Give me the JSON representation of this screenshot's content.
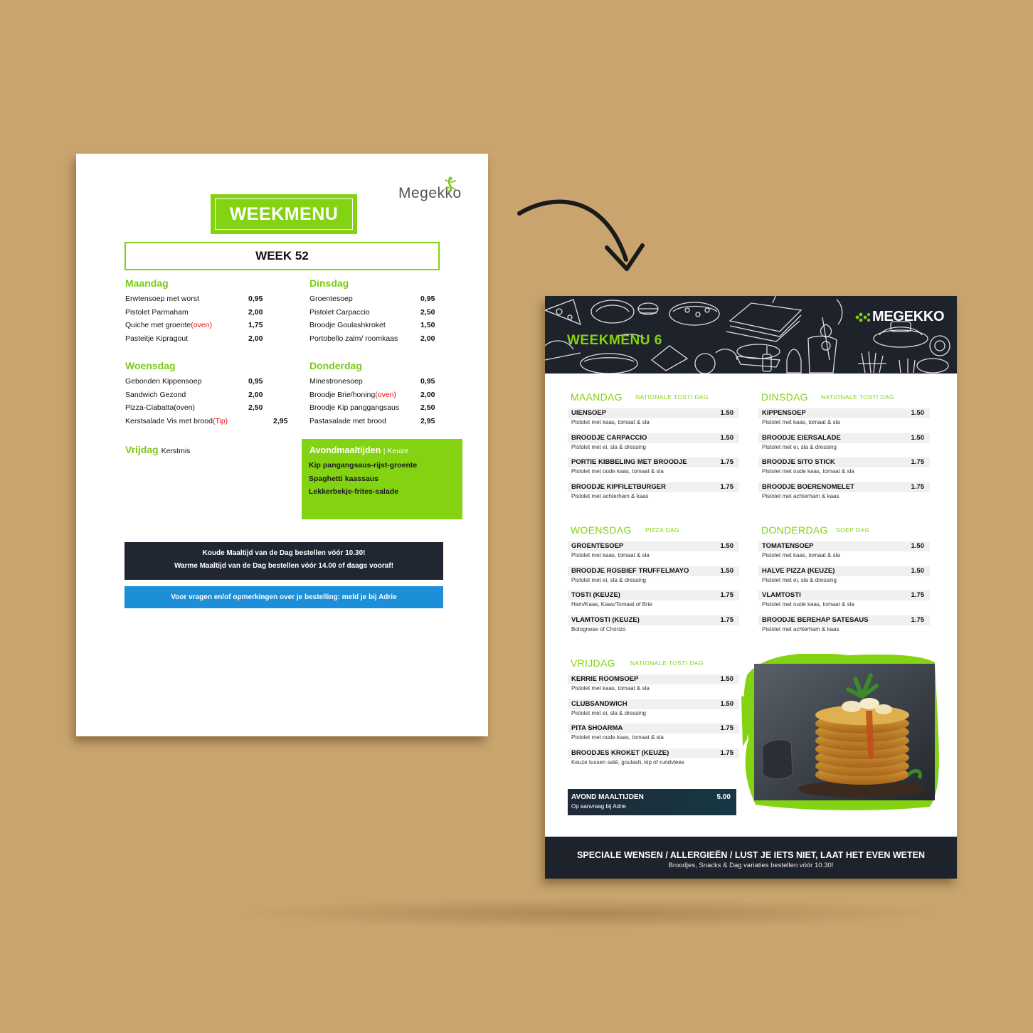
{
  "colors": {
    "background": "#c9a46e",
    "green": "#84d312",
    "dark": "#1e222a",
    "blue": "#1d8fd8",
    "red": "#e01010"
  },
  "old_menu": {
    "logo": "Megekko",
    "title": "WEEKMENU",
    "week": "WEEK 52",
    "days": [
      {
        "name": "Maandag",
        "items": [
          {
            "name": "Erwtensoep met worst",
            "price": "0,95"
          },
          {
            "name": "Pistolet Parmaham",
            "price": "2,00"
          },
          {
            "name": "Quiche met groente",
            "note": "(oven)",
            "price": "1,75"
          },
          {
            "name": "Pasteitje Kipragout",
            "price": "2,00"
          }
        ]
      },
      {
        "name": "Dinsdag",
        "items": [
          {
            "name": "Groentesoep",
            "price": "0,95"
          },
          {
            "name": "Pistolet Carpaccio",
            "price": "2,50"
          },
          {
            "name": "Broodje Goulashkroket",
            "price": "1,50"
          },
          {
            "name": "Portobello zalm/ roomkaas",
            "price": "2,00"
          }
        ]
      },
      {
        "name": "Woensdag",
        "items": [
          {
            "name": "Gebonden Kippensoep",
            "price": "0,95"
          },
          {
            "name": "Sandwich Gezond",
            "price": "2,00"
          },
          {
            "name": "Pizza-Ciabatta(oven)",
            "price": "2,50"
          },
          {
            "name": "Kerstsalade Vis met brood",
            "note": "(Tip)",
            "price": "2,95"
          }
        ]
      },
      {
        "name": "Donderdag",
        "items": [
          {
            "name": "Minestronesoep",
            "price": "0,95"
          },
          {
            "name": "Broodje Brie/honing",
            "note": "(oven)",
            "price": "2,00"
          },
          {
            "name": "Broodje Kip panggangsaus",
            "price": "2,50"
          },
          {
            "name": "Pastasalade met brood",
            "price": "2,95"
          }
        ]
      }
    ],
    "friday": {
      "name": "Vrijdag",
      "note": "Kerstmis"
    },
    "evening": {
      "title": "Avondmaaltijden",
      "sub": "| Keuze",
      "items": [
        "Kip pangangsaus-rijst-groente",
        "Spaghetti kaassaus",
        "Lekkerbekje-frites-salade"
      ]
    },
    "notice_line1": "Koude Maaltijd van de Dag bestellen vóór 10.30!",
    "notice_line2": "Warme Maaltijd van de Dag bestellen vóór 14.00 of daags vooraf!",
    "contact": "Voor vragen en/of opmerkingen over je bestelling: meld je bij Adrie"
  },
  "new_menu": {
    "logo": "MEGEKKO",
    "title": "WEEKMENU 6",
    "days": [
      {
        "name": "MAANDAG",
        "sub": "NATIONALE TOSTI DAG",
        "items": [
          {
            "name": "UIENSOEP",
            "price": "1.50",
            "desc": "Pistolet met kaas, tomaat & sla"
          },
          {
            "name": "BROODJE CARPACCIO",
            "price": "1.50",
            "desc": "Pistolet met ei, sla & dressing"
          },
          {
            "name": "PORTIE KIBBELING MET BROODJE",
            "price": "1.75",
            "desc": "Pistolet met oude kaas, tomaat & sla"
          },
          {
            "name": "BROODJE KIPFILETBURGER",
            "price": "1.75",
            "desc": "Pistolet met achterham & kaas"
          }
        ]
      },
      {
        "name": "DINSDAG",
        "sub": "NATIONALE TOSTI DAG",
        "items": [
          {
            "name": "KIPPENSOEP",
            "price": "1.50",
            "desc": "Pistolet met kaas, tomaat & sla"
          },
          {
            "name": "BROODJE EIERSALADE",
            "price": "1.50",
            "desc": "Pistolet met ei, sla & dressing"
          },
          {
            "name": "BROODJE SITO STICK",
            "price": "1.75",
            "desc": "Pistolet met oude kaas, tomaat & sla"
          },
          {
            "name": "BROODJE BOERENOMELET",
            "price": "1.75",
            "desc": "Pistolet met achterham & kaas"
          }
        ]
      },
      {
        "name": "WOENSDAG",
        "sub": "PIZZA DAG",
        "items": [
          {
            "name": "GROENTESOEP",
            "price": "1.50",
            "desc": "Pistolet met kaas, tomaat & sla"
          },
          {
            "name": "BROODJE ROSBIEF TRUFFELMAYO",
            "price": "1.50",
            "desc": "Pistolet met ei, sla & dressing"
          },
          {
            "name": "TOSTI (KEUZE)",
            "price": "1.75",
            "desc": "Ham/Kaas, Kaas/Tomaat of Brie"
          },
          {
            "name": "VLAMTOSTI (KEUZE)",
            "price": "1.75",
            "desc": "Bolognese of Chorizo"
          }
        ]
      },
      {
        "name": "DONDERDAG",
        "sub": "SOEP DAG",
        "items": [
          {
            "name": "TOMATENSOEP",
            "price": "1.50",
            "desc": "Pistolet met kaas, tomaat & sla"
          },
          {
            "name": "HALVE PIZZA (KEUZE)",
            "price": "1.50",
            "desc": "Pistolet met ei, sla & dressing"
          },
          {
            "name": "VLAMTOSTI",
            "price": "1.75",
            "desc": "Pistolet met oude kaas, tomaat & sla"
          },
          {
            "name": "BROODJE BEREHAP SATESAUS",
            "price": "1.75",
            "desc": "Pistolet met achterham & kaas"
          }
        ]
      },
      {
        "name": "VRIJDAG",
        "sub": "NATIONALE TOSTI DAG",
        "items": [
          {
            "name": "KERRIE ROOMSOEP",
            "price": "1.50",
            "desc": "Pistolet met kaas, tomaat & sla"
          },
          {
            "name": "CLUBSANDWICH",
            "price": "1.50",
            "desc": "Pistolet met ei, sla & dressing"
          },
          {
            "name": "PITA SHOARMA",
            "price": "1.75",
            "desc": "Pistolet met oude kaas, tomaat & sla"
          },
          {
            "name": "BROODJES KROKET (KEUZE)",
            "price": "1.75",
            "desc": "Keuze tussen saté, goulash, kip of rundvlees"
          }
        ]
      }
    ],
    "evening": {
      "name": "AVOND MAALTIJDEN",
      "desc": "Op aanvraag bij Adrie",
      "price": "5.00"
    },
    "footer_line1": "SPECIALE WENSEN / ALLERGIEËN / LUST JE IETS NIET, LAAT HET EVEN WETEN",
    "footer_line2": "Broodjes, Snacks & Dag variaties bestellen vóór 10.30!"
  }
}
